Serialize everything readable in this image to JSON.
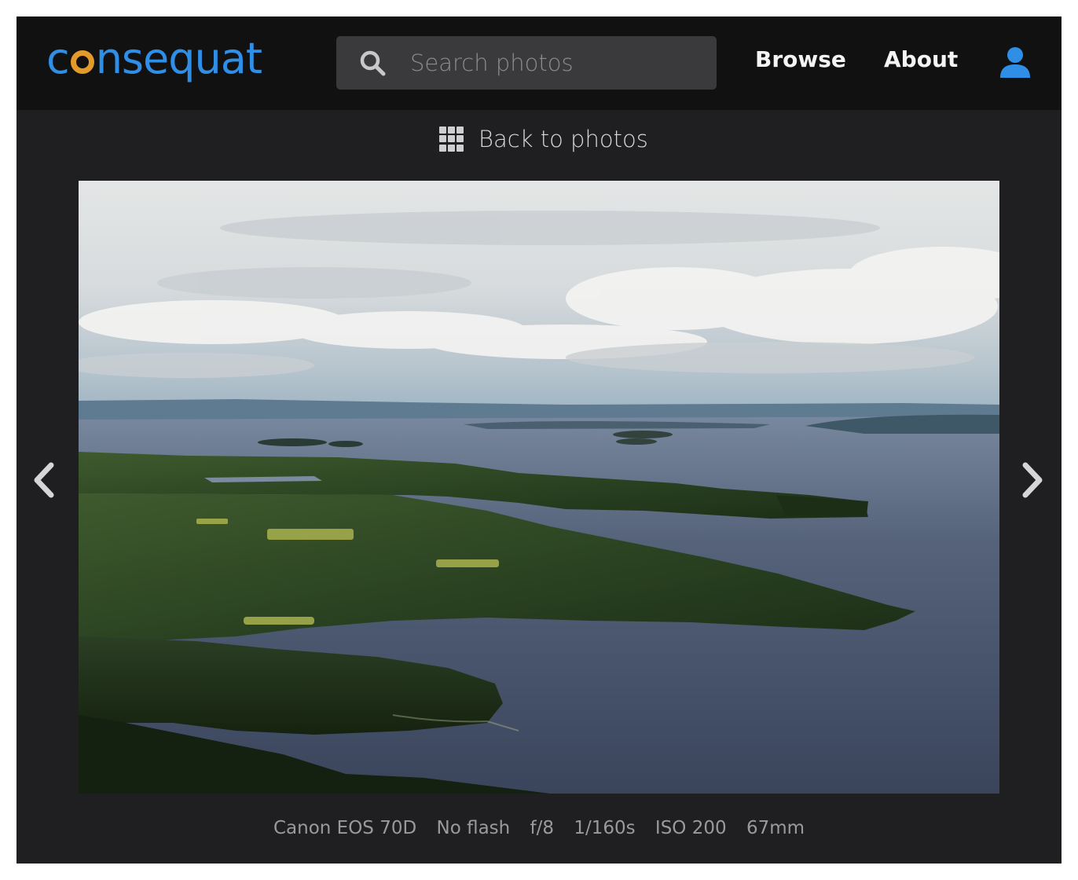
{
  "brand": {
    "name": "consequat",
    "prefix": "c",
    "ring_letter": "o",
    "suffix": "nsequat",
    "text_color": "#2f8fe6",
    "ring_color": "#e39a2b"
  },
  "search": {
    "placeholder": "Search photos",
    "value": "",
    "icon": "search-icon"
  },
  "nav": {
    "browse": "Browse",
    "about": "About",
    "user_icon": "user-icon",
    "accent": "#2f8fe6"
  },
  "back": {
    "label": "Back to photos",
    "icon": "grid-icon"
  },
  "photo": {
    "subject": "aerial landscape photo"
  },
  "arrows": {
    "prev_icon": "chevron-left-icon",
    "next_icon": "chevron-right-icon"
  },
  "exif": {
    "camera": "Canon EOS 70D",
    "flash": "No flash",
    "aperture": "f/8",
    "shutter": "1/160s",
    "iso": "ISO 200",
    "focal_length": "67mm"
  }
}
